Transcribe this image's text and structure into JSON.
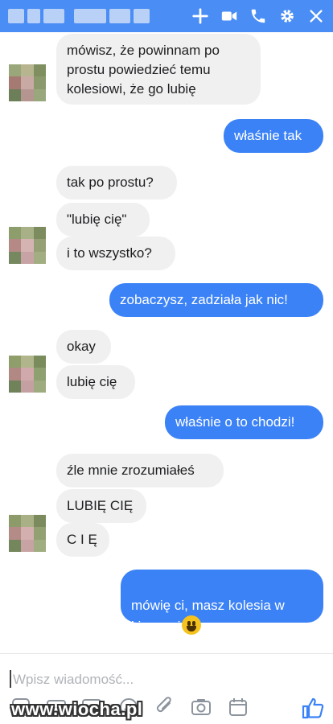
{
  "header": {
    "title_hidden": "",
    "icons": [
      "plus-icon",
      "video-call-icon",
      "phone-icon",
      "settings-gear-icon",
      "close-icon"
    ],
    "background": "#4a8ef5"
  },
  "messages": [
    {
      "side": "received",
      "text": "mówisz, że powinnam po\nprostu powiedzieć temu\nkolesiowi, że go lubię"
    },
    {
      "side": "sent",
      "text": "właśnie tak"
    },
    {
      "side": "received",
      "text": "tak po prostu?"
    },
    {
      "side": "received",
      "text": "\"lubię cię\""
    },
    {
      "side": "received",
      "text": "i to wszystko?"
    },
    {
      "side": "sent",
      "text": "zobaczysz, zadziała jak nic!"
    },
    {
      "side": "received",
      "text": "okay"
    },
    {
      "side": "received",
      "text": "lubię cię"
    },
    {
      "side": "sent",
      "text": "właśnie o to chodzi!"
    },
    {
      "side": "received",
      "text": "źle mnie zrozumiałeś"
    },
    {
      "side": "received",
      "text": "LUBIĘ CIĘ"
    },
    {
      "side": "received",
      "text": "C I Ę"
    },
    {
      "side": "sent",
      "text": "mówię ci, masz kolesia w\nkieszeni",
      "emoji": "grinning-face-emoji"
    }
  ],
  "composer": {
    "placeholder": "Wpisz wiadomość...",
    "tools": [
      "sticker-icon",
      "gif-icon",
      "image-icon",
      "emoji-icon",
      "attachment-icon",
      "camera-icon",
      "calendar-icon"
    ],
    "like_icon": "thumbs-up-icon"
  },
  "watermark": "www.wiocha.pl",
  "colors": {
    "sent_bubble": "#3b82f6",
    "received_bubble": "#f1f0f0",
    "accent": "#4a8ef5"
  }
}
